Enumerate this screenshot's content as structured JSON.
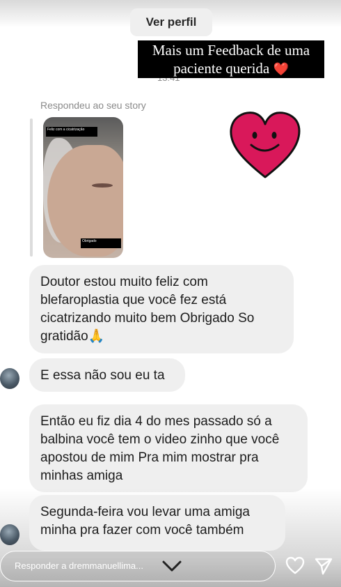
{
  "header": {
    "profile_button": "Ver perfil",
    "time": "13:41"
  },
  "caption": {
    "line1": "Mais um Feedback de uma",
    "line2": "paciente querida",
    "emoji": "❤️"
  },
  "story": {
    "label": "Respondeu ao seu story",
    "thumb_top_text": "Feliz com a cicatrização",
    "thumb_bottom_text": "Obrigado"
  },
  "messages": [
    {
      "text": "Doutor estou muito feliz com blefaroplastia  que você fez está cicatrizando muito bem Obrigado So gratidão🙏"
    },
    {
      "text": "E essa não sou eu ta"
    },
    {
      "text": "Então eu fiz dia 4 do mes passado só a balbina você tem o video zinho que você apostou de mim Pra mim mostrar pra minhas amiga"
    },
    {
      "text": "Segunda-feira vou levar uma amiga minha pra fazer com você também"
    }
  ],
  "composer": {
    "placeholder": "Responder a dremmanuellima..."
  },
  "icons": {
    "chevron": "chevron-down-icon",
    "like": "heart-icon",
    "send": "send-icon",
    "sticker": "smiling-heart-sticker"
  },
  "colors": {
    "bubble": "#efefef",
    "heart_sticker": "#d9185a",
    "caption_bg": "#000000"
  }
}
